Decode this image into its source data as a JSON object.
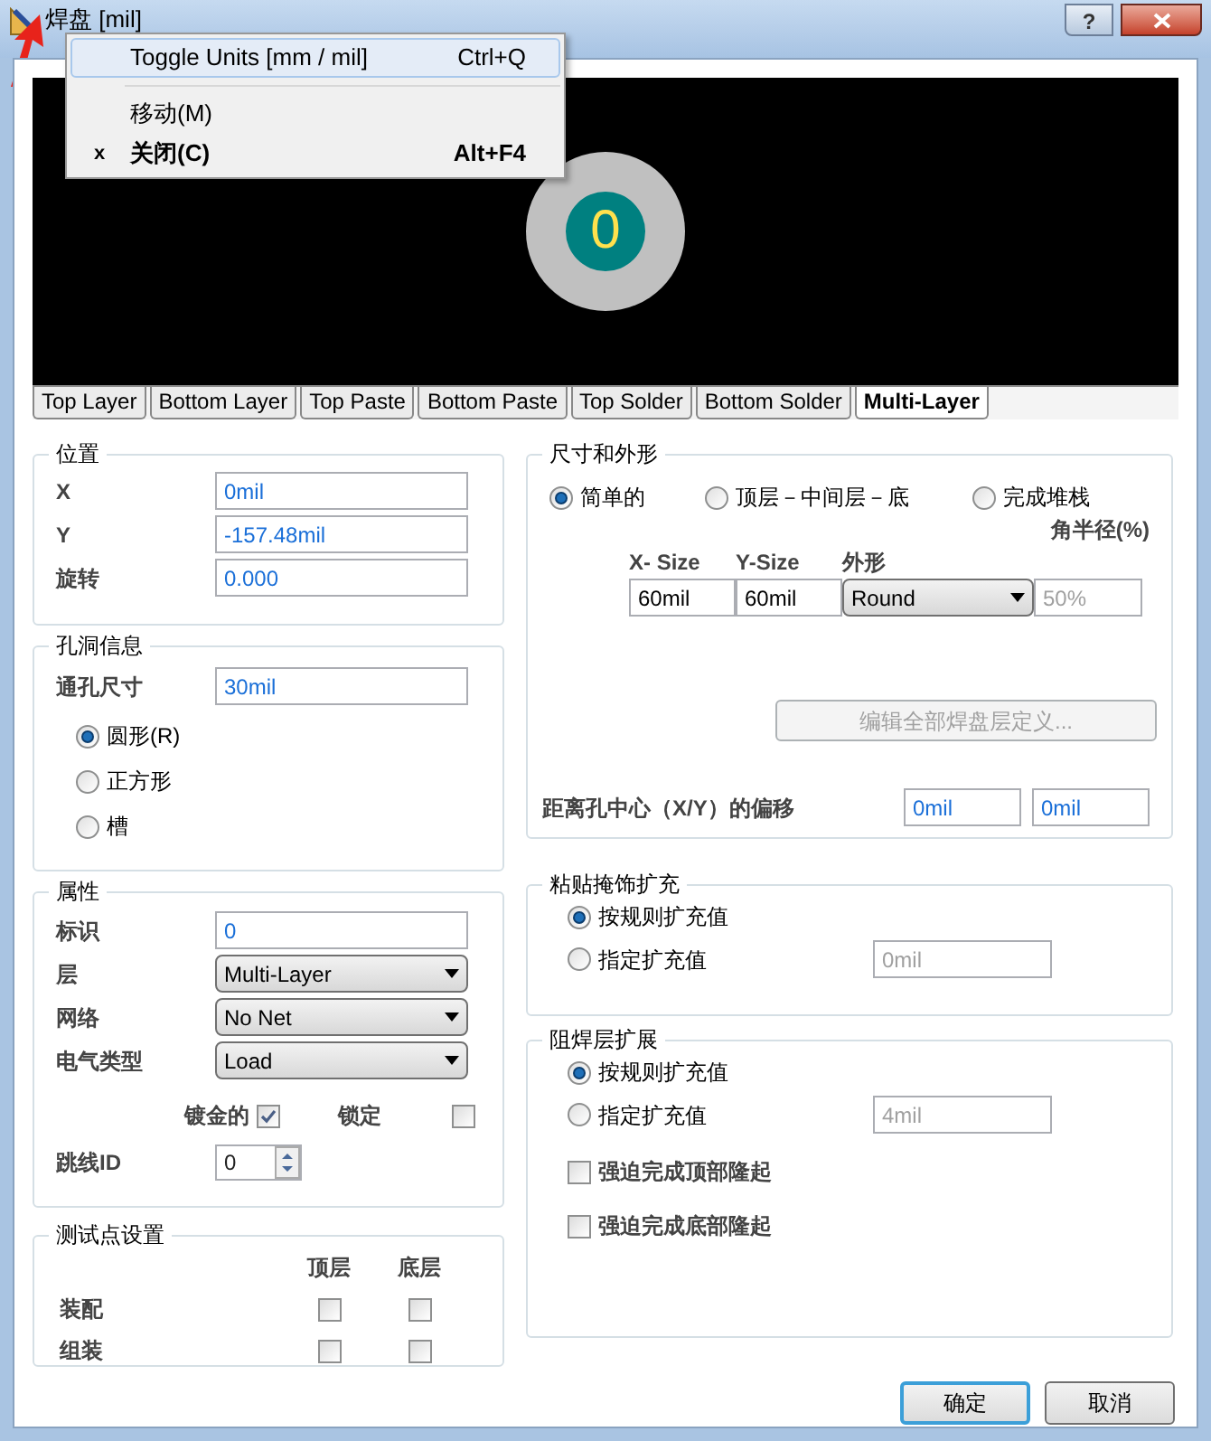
{
  "window": {
    "title": "焊盘 [mil]",
    "help_label": "?"
  },
  "system_menu": [
    {
      "label": "Toggle Units [mm / mil]",
      "shortcut": "Ctrl+Q",
      "selected": true,
      "bold": false
    },
    {
      "kind": "separator"
    },
    {
      "label": "移动(M)",
      "selected": false,
      "bold": false
    },
    {
      "mark": "x",
      "label": "关闭(C)",
      "shortcut": "Alt+F4",
      "selected": false,
      "bold": true
    }
  ],
  "preview": {
    "pad_label": "0"
  },
  "tabs": [
    {
      "label": "Top Layer",
      "selected": false
    },
    {
      "label": "Bottom Layer",
      "selected": false
    },
    {
      "label": "Top Paste",
      "selected": false
    },
    {
      "label": "Bottom Paste",
      "selected": false
    },
    {
      "label": "Top Solder",
      "selected": false
    },
    {
      "label": "Bottom Solder",
      "selected": false
    },
    {
      "label": "Multi-Layer",
      "selected": true
    }
  ],
  "position": {
    "title": "位置",
    "fields": [
      {
        "label": "X",
        "value": "0mil"
      },
      {
        "label": "Y",
        "value": "-157.48mil"
      },
      {
        "label": "旋转",
        "value": "0.000"
      }
    ]
  },
  "hole": {
    "title": "孔洞信息",
    "size_label": "通孔尺寸",
    "size_value": "30mil",
    "shapes": [
      {
        "label": "圆形(R)",
        "selected": true
      },
      {
        "label": "正方形",
        "selected": false
      },
      {
        "label": "槽",
        "selected": false
      }
    ]
  },
  "properties": {
    "title": "属性",
    "designator_label": "标识",
    "designator_value": "0",
    "dropdowns": [
      {
        "label": "层",
        "value": "Multi-Layer"
      },
      {
        "label": "网络",
        "value": "No Net"
      },
      {
        "label": "电气类型",
        "value": "Load"
      }
    ],
    "checks": [
      {
        "label": "镀金的",
        "checked": true
      },
      {
        "label": "锁定",
        "checked": false
      }
    ],
    "jumper_label": "跳线ID",
    "jumper_value": "0"
  },
  "testpoint": {
    "title": "测试点设置",
    "columns": [
      "顶层",
      "底层"
    ],
    "rows": [
      {
        "label": "装配",
        "checks": [
          false,
          false
        ]
      },
      {
        "label": "组装",
        "checks": [
          false,
          false
        ]
      }
    ]
  },
  "size_shape": {
    "title": "尺寸和外形",
    "modes": [
      {
        "label": "简单的",
        "selected": true
      },
      {
        "label": "顶层－中间层－底",
        "selected": false
      },
      {
        "label": "完成堆栈",
        "selected": false
      }
    ],
    "corner_label": "角半径(%)",
    "columns": [
      "X- Size",
      "Y-Size",
      "外形"
    ],
    "x_size": "60mil",
    "y_size": "60mil",
    "shape": "Round",
    "corner_value": "50%",
    "edit_button": {
      "label": "编辑全部焊盘层定义...",
      "disabled": true
    },
    "offset_label": "距离孔中心（X/Y）的偏移",
    "offset_x": "0mil",
    "offset_y": "0mil"
  },
  "paste_mask": {
    "title": "粘贴掩饰扩充",
    "options": [
      {
        "label": "按规则扩充值",
        "selected": true
      },
      {
        "label": "指定扩充值",
        "selected": false
      }
    ],
    "value": "0mil"
  },
  "solder_mask": {
    "title": "阻焊层扩展",
    "options": [
      {
        "label": "按规则扩充值",
        "selected": true
      },
      {
        "label": "指定扩充值",
        "selected": false
      }
    ],
    "value": "4mil",
    "checks": [
      {
        "label": "强迫完成顶部隆起",
        "checked": false
      },
      {
        "label": "强迫完成底部隆起",
        "checked": false
      }
    ]
  },
  "buttons": [
    {
      "label": "确定",
      "default": true
    },
    {
      "label": "取消",
      "default": false
    }
  ]
}
